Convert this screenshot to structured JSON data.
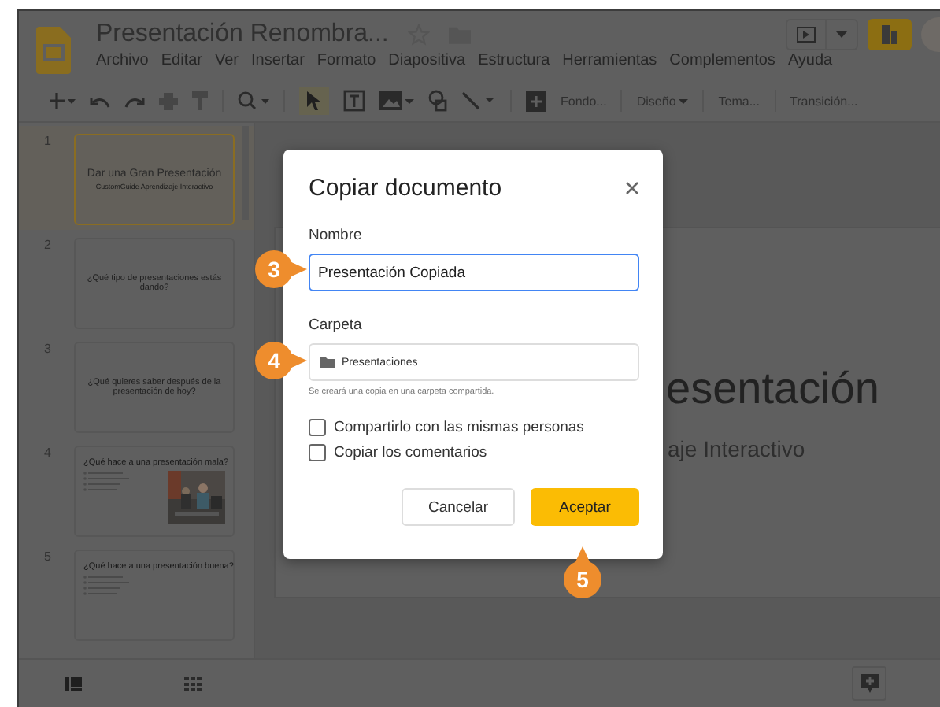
{
  "document": {
    "title": "Presentación Renombra..."
  },
  "menu": [
    "Archivo",
    "Editar",
    "Ver",
    "Insertar",
    "Formato",
    "Diapositiva",
    "Estructura",
    "Herramientas",
    "Complementos",
    "Ayuda"
  ],
  "toolbar": {
    "buttons": [
      "Fondo...",
      "Diseño",
      "Tema...",
      "Transición..."
    ]
  },
  "slides": [
    {
      "number": "1",
      "selected": true,
      "kind": "title",
      "title": "Dar una Gran Presentación",
      "subtitle": "CustomGuide Aprendizaje Interactivo"
    },
    {
      "number": "2",
      "selected": false,
      "kind": "question",
      "title": "¿Qué tipo de presentaciones estás dando?"
    },
    {
      "number": "3",
      "selected": false,
      "kind": "question",
      "title": "¿Qué quieres saber después de la presentación de hoy?"
    },
    {
      "number": "4",
      "selected": false,
      "kind": "bullets",
      "title": "¿Qué hace a una presentación mala?",
      "picture": true
    },
    {
      "number": "5",
      "selected": false,
      "kind": "bullets",
      "title": "¿Qué hace a una presentación buena?",
      "picture": false
    }
  ],
  "canvas": {
    "title": "esentación",
    "subtitle": "aje Interactivo"
  },
  "dialog": {
    "title": "Copiar documento",
    "name_label": "Nombre",
    "name_value": "Presentación Copiada",
    "folder_label": "Carpeta",
    "folder_value": "Presentaciones",
    "folder_hint": "Se creará una copia en una carpeta compartida.",
    "options": [
      {
        "label": "Compartirlo con las mismas personas",
        "checked": false
      },
      {
        "label": "Copiar los comentarios",
        "checked": false
      }
    ],
    "cancel": "Cancelar",
    "accept": "Aceptar"
  },
  "callouts": [
    {
      "number": "3"
    },
    {
      "number": "4"
    },
    {
      "number": "5"
    }
  ]
}
